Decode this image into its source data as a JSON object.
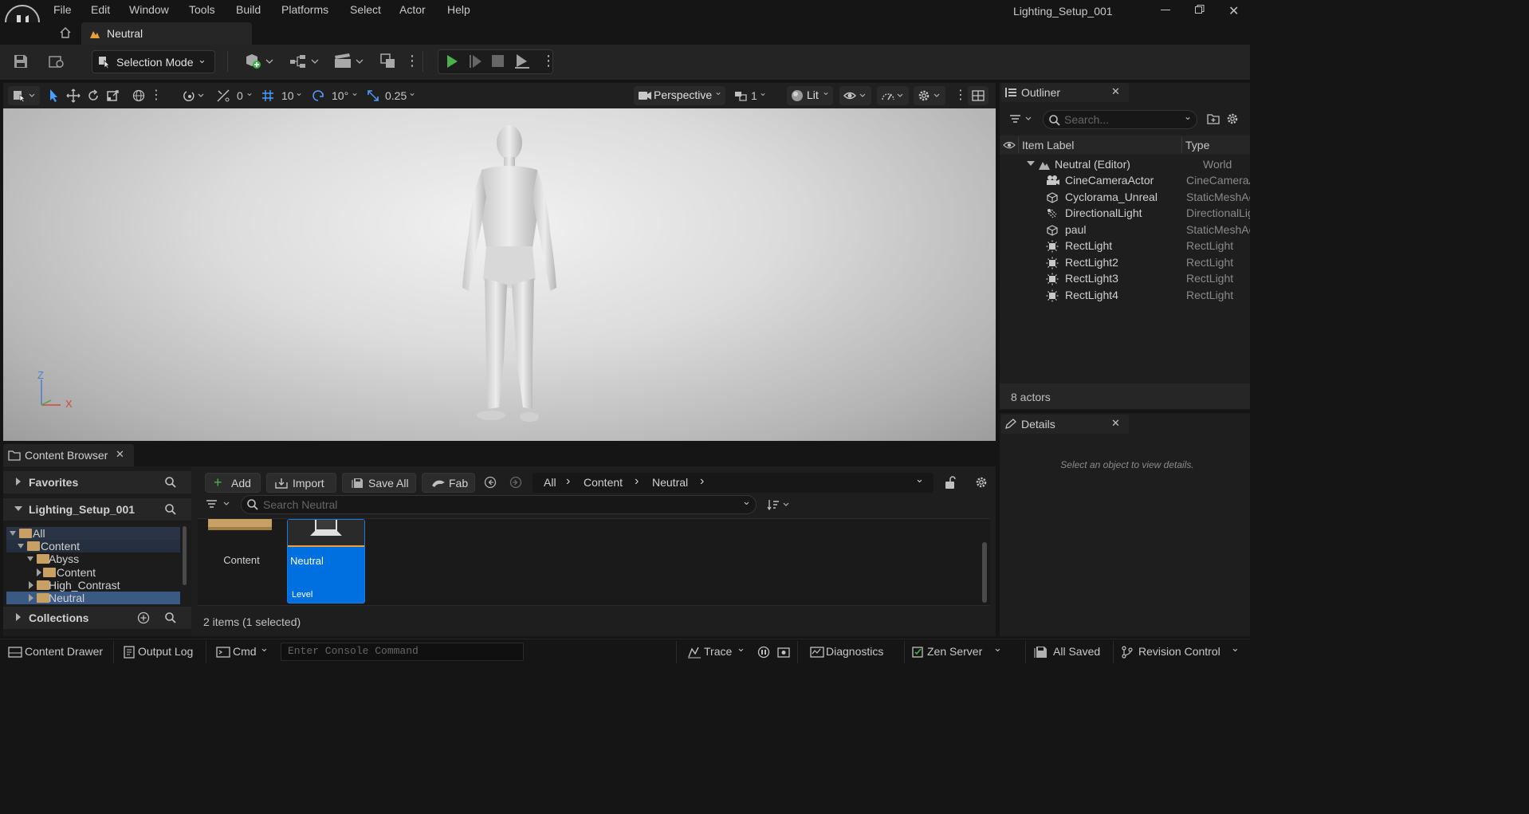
{
  "window": {
    "title": "Lighting_Setup_001"
  },
  "menu": [
    "File",
    "Edit",
    "Window",
    "Tools",
    "Build",
    "Platforms",
    "Select",
    "Actor",
    "Help"
  ],
  "doc_tab": {
    "label": "Neutral"
  },
  "toolbar": {
    "selection_mode": "Selection Mode"
  },
  "viewport_toolbar": {
    "rotation_snap_value": "0",
    "grid_snap_value": "10",
    "angle_snap_value": "10°",
    "scale_snap_value": "0.25",
    "view_mode": "Perspective",
    "camera_speed": "1",
    "lit_mode": "Lit"
  },
  "viewport": {
    "axis_z": "Z",
    "axis_x": "X"
  },
  "outliner": {
    "title": "Outliner",
    "search_placeholder": "Search...",
    "col_label": "Item Label",
    "col_type": "Type",
    "root": {
      "label": "Neutral (Editor)",
      "type": "World"
    },
    "items": [
      {
        "label": "CineCameraActor",
        "type": "CineCameraActor",
        "icon": "camera-icon"
      },
      {
        "label": "Cyclorama_Unreal",
        "type": "StaticMeshActor",
        "icon": "cube-icon"
      },
      {
        "label": "DirectionalLight",
        "type": "DirectionalLight",
        "icon": "light-icon"
      },
      {
        "label": "paul",
        "type": "StaticMeshActor",
        "icon": "cube-icon"
      },
      {
        "label": "RectLight",
        "type": "RectLight",
        "icon": "rect-light-icon"
      },
      {
        "label": "RectLight2",
        "type": "RectLight",
        "icon": "rect-light-icon"
      },
      {
        "label": "RectLight3",
        "type": "RectLight",
        "icon": "rect-light-icon"
      },
      {
        "label": "RectLight4",
        "type": "RectLight",
        "icon": "rect-light-icon"
      }
    ],
    "actor_count": "8 actors"
  },
  "details": {
    "title": "Details",
    "empty_message": "Select an object to view details."
  },
  "content_browser": {
    "tab_title": "Content Browser",
    "favorites": "Favorites",
    "project": "Lighting_Setup_001",
    "collections": "Collections",
    "tree": [
      {
        "label": "All"
      },
      {
        "label": "Content"
      },
      {
        "label": "Abyss"
      },
      {
        "label": "Content"
      },
      {
        "label": "High_Contrast"
      },
      {
        "label": "Neutral"
      }
    ],
    "buttons": {
      "add": "Add",
      "import": "Import",
      "save_all": "Save All",
      "fab": "Fab"
    },
    "path": [
      "All",
      "Content",
      "Neutral"
    ],
    "search_placeholder": "Search Neutral",
    "assets": [
      {
        "name": "Content"
      },
      {
        "name": "Neutral",
        "type": "Level"
      }
    ],
    "item_count": "2 items (1 selected)"
  },
  "statusbar": {
    "content_drawer": "Content Drawer",
    "output_log": "Output Log",
    "cmd": "Cmd",
    "console_placeholder": "Enter Console Command",
    "trace": "Trace",
    "diagnostics": "Diagnostics",
    "zen_server": "Zen Server",
    "all_saved": "All Saved",
    "revision_control": "Revision Control"
  },
  "colors": {
    "accent": "#0070e0",
    "play_green": "#4caf50",
    "folder": "#c8a063",
    "axis_z": "#4a7fd0",
    "axis_x": "#d04a3a"
  }
}
